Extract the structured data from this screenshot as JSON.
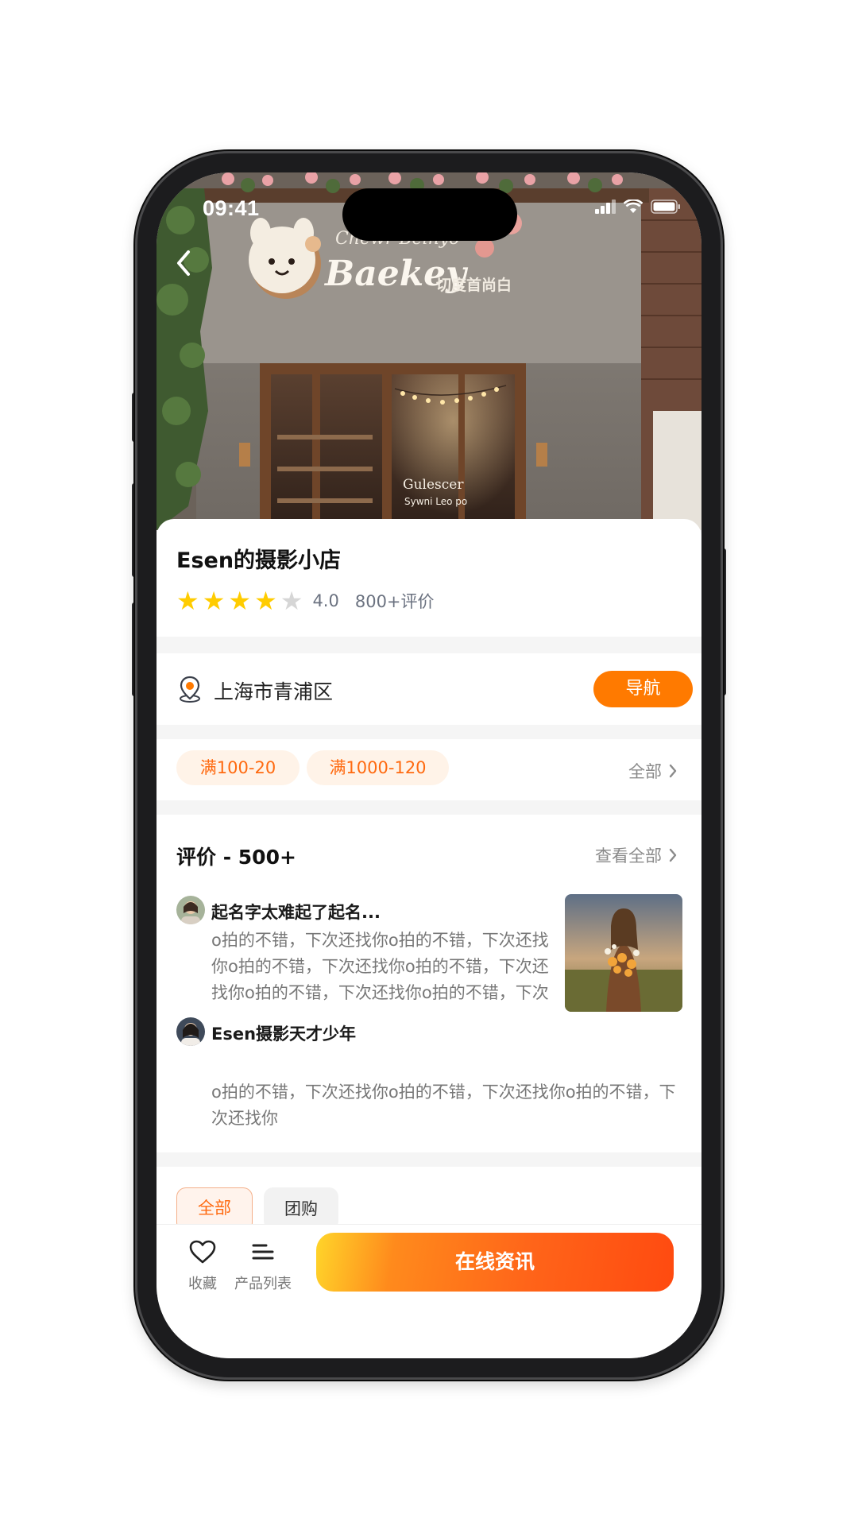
{
  "status_bar": {
    "time": "09:41"
  },
  "shop": {
    "name": "Esen的摄影小店",
    "rating": 4.0,
    "rating_text": "4.0",
    "review_count": "800+评价",
    "stars_filled": 4,
    "stars_total": 5
  },
  "location": {
    "address": "上海市青浦区",
    "nav_label": "导航"
  },
  "coupons": {
    "items": [
      "满100-20",
      "满1000-120"
    ],
    "all_label": "全部"
  },
  "reviews": {
    "title": "评价 - 500+",
    "view_all_label": "查看全部",
    "items": [
      {
        "name": "起名字太难起了起名...",
        "text": "o拍的不错，下次还找你o拍的不错，下次还找你o拍的不错，下次还找你o拍的不错，下次还找你o拍的不错，下次还找你o拍的不错，下次还找你"
      },
      {
        "name": "Esen摄影天才少年",
        "text": "o拍的不错，下次还找你o拍的不错，下次还找你o拍的不错，下次还找你"
      }
    ]
  },
  "tabs": [
    "全部",
    "团购"
  ],
  "bottom_bar": {
    "favorite_label": "收藏",
    "product_list_label": "产品列表",
    "consult_label": "在线资讯"
  },
  "colors": {
    "accent": "#ff7a00",
    "coupon_text": "#ff6a10",
    "coupon_bg": "#fff3e8",
    "star": "#ffcc00",
    "star_off": "#d6d6d6"
  },
  "hero_signage": {
    "sign_top": "Chewr Beinyo",
    "sign_main": "Baekey",
    "sign_cn": "切度首尚白",
    "window_sign": "Gulescer",
    "window_sub": "Sywni Leo po"
  }
}
